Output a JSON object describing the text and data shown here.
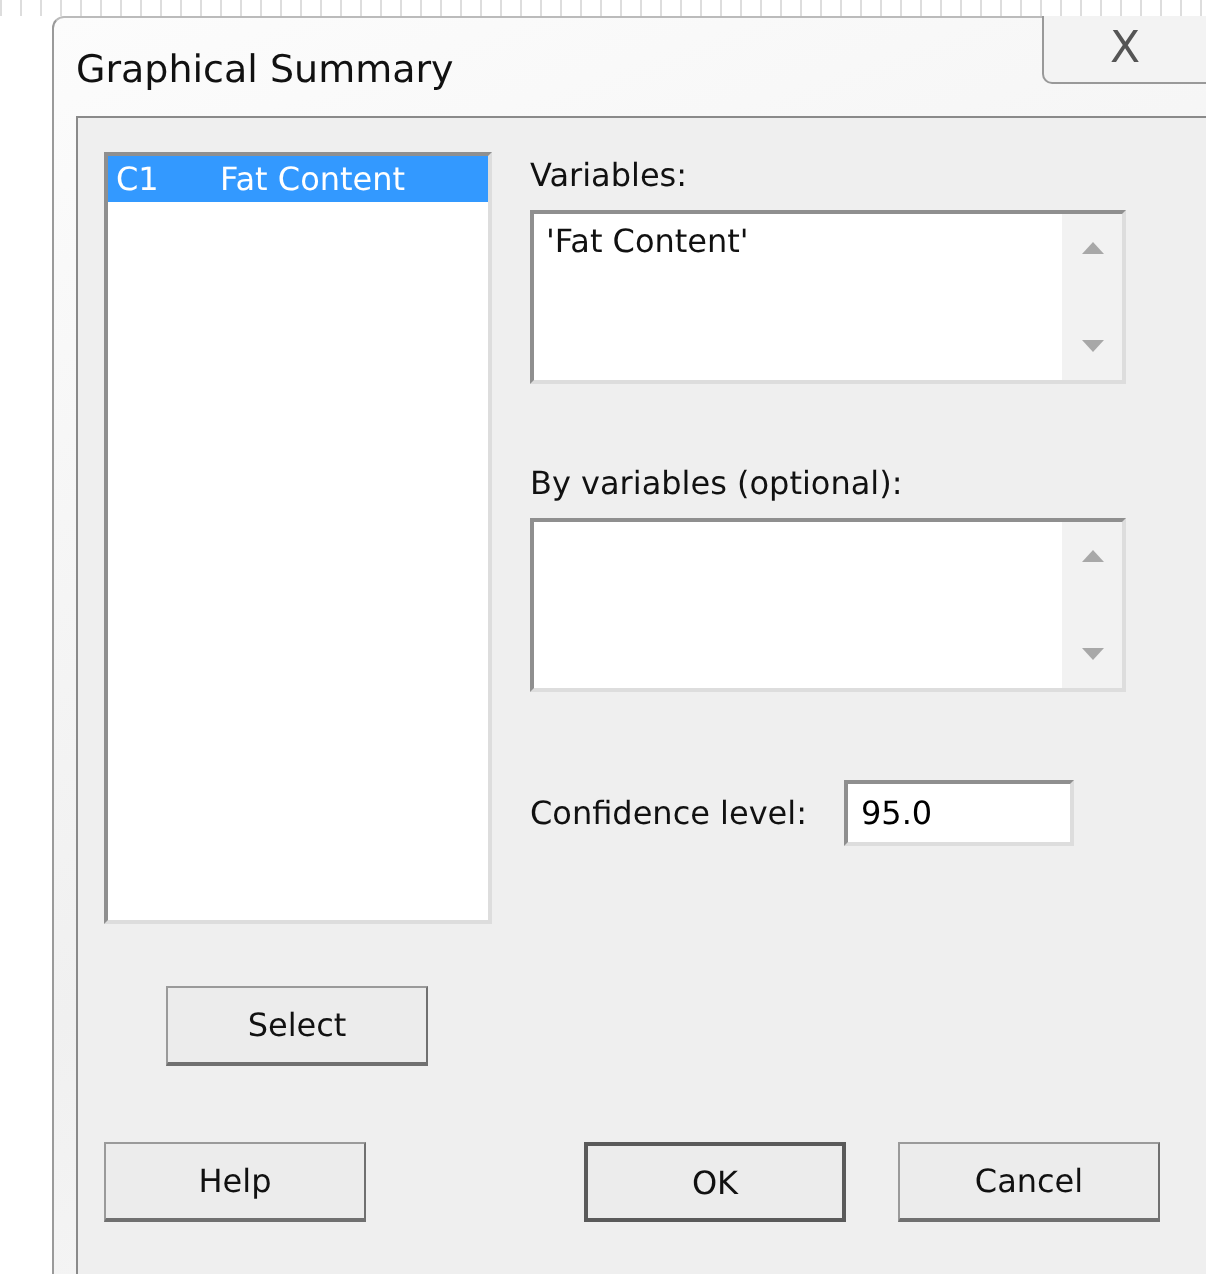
{
  "window": {
    "title": "Graphical Summary",
    "close": "X"
  },
  "columns_list": {
    "items": [
      {
        "column": "C1",
        "name": "Fat Content",
        "selected": true
      }
    ]
  },
  "variables": {
    "label": "Variables:",
    "value": "'Fat Content'"
  },
  "by_variables": {
    "label": "By variables (optional):"
  },
  "confidence": {
    "label": "Confidence level:",
    "value": "95.0"
  },
  "buttons": [
    {
      "label": "Select",
      "kind": "select"
    },
    {
      "label": "Help",
      "kind": "footer"
    },
    {
      "label": "OK",
      "kind": "footer",
      "default": true
    },
    {
      "label": "Cancel",
      "kind": "footer",
      "default": false
    }
  ]
}
